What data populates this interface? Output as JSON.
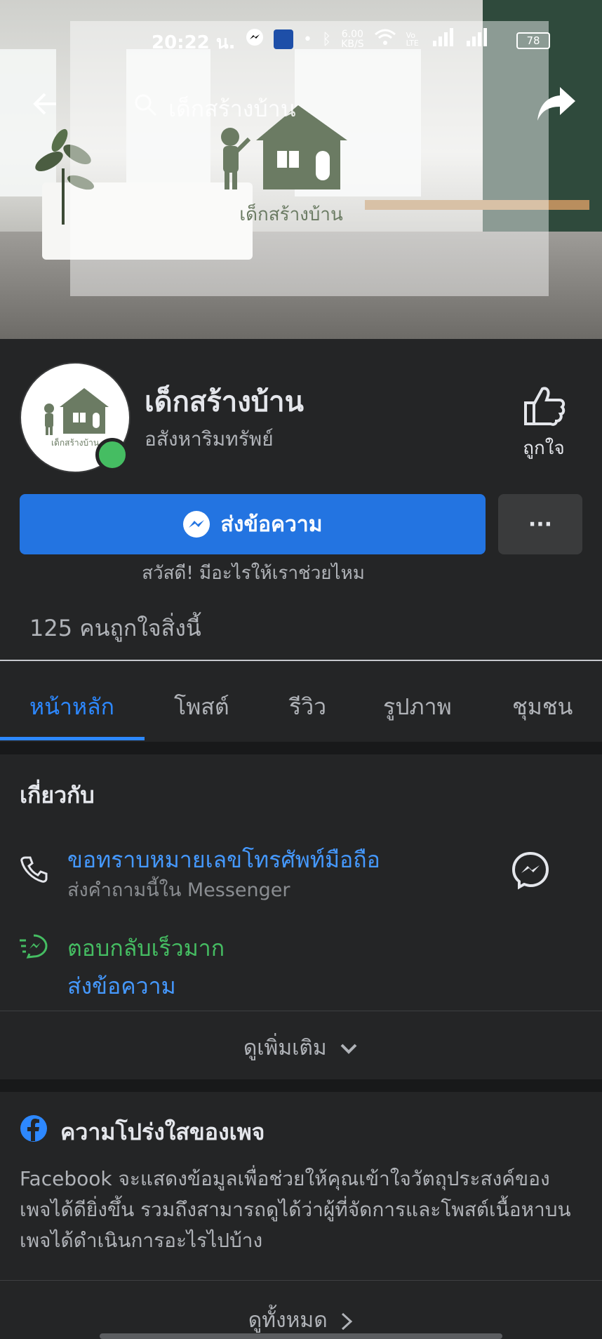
{
  "status_bar": {
    "time": "20:22 น.",
    "net_speed": "6.00",
    "net_unit": "KB/S",
    "volte": "Vo LTE",
    "battery": "78"
  },
  "cover": {
    "search_text": "เด็กสร้างบ้าน",
    "logo_caption": "เด็กสร้างบ้าน"
  },
  "profile": {
    "name": "เด็กสร้างบ้าน",
    "category": "อสังหาริมทรัพย์",
    "avatar_caption": "เด็กสร้างบ้าน",
    "like_label": "ถูกใจ",
    "message_button": "ส่งข้อความ",
    "more_button": "···",
    "greeting": "สวัสดี! มีอะไรให้เราช่วยไหม",
    "likes_count": "125 คนถูกใจสิ่งนี้"
  },
  "tabs": [
    {
      "label": "หน้าหลัก",
      "active": true
    },
    {
      "label": "โพสต์"
    },
    {
      "label": "รีวิว"
    },
    {
      "label": "รูปภาพ"
    },
    {
      "label": "ชุมชน"
    }
  ],
  "about": {
    "title": "เกี่ยวกับ",
    "ask_title": "ขอทราบหมายเลขโทรศัพท์มือถือ",
    "ask_sub": "ส่งคำถามนี้ใน Messenger",
    "fast_reply": "ตอบกลับเร็วมาก",
    "send_message_link": "ส่งข้อความ",
    "see_more": "ดูเพิ่มเติม"
  },
  "transparency": {
    "title": "ความโปร่งใสของเพจ",
    "body": "Facebook จะแสดงข้อมูลเพื่อช่วยให้คุณเข้าใจวัตถุประสงค์ของเพจได้ดียิ่งขึ้น รวมถึงสามารถดูได้ว่าผู้ที่จัดการและโพสต์เนื้อหาบนเพจได้ดำเนินการอะไรไปบ้าง",
    "see_all": "ดูทั้งหมด"
  },
  "colors": {
    "background": "#242526",
    "accent_blue": "#2374e1",
    "link_blue": "#4599ff",
    "green": "#45bd62",
    "logo_green": "#6b7b63"
  }
}
